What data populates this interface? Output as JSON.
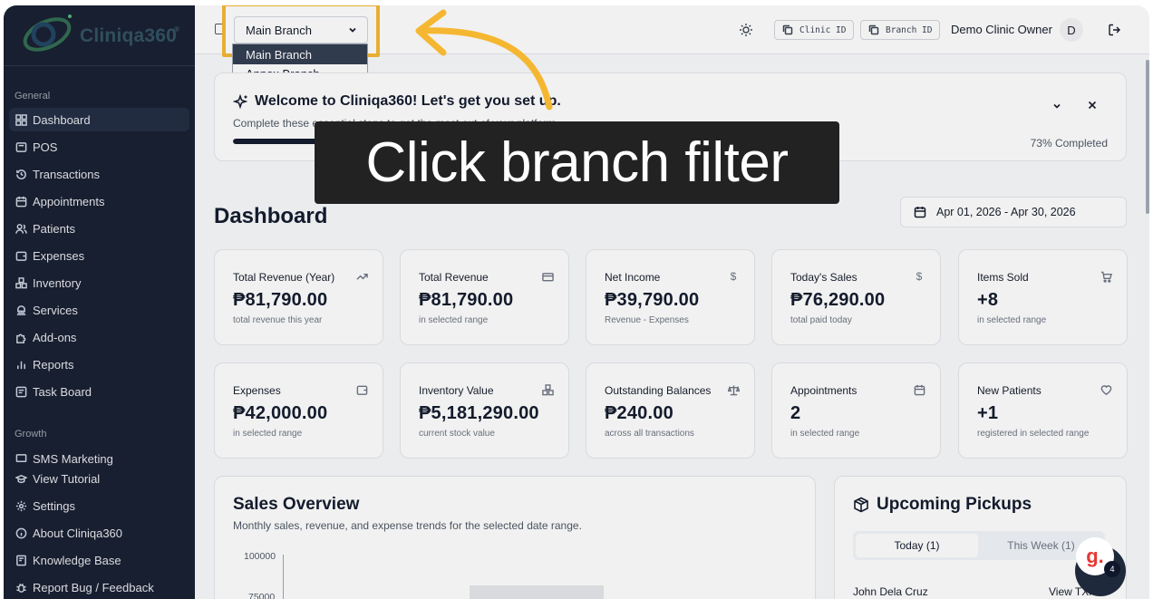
{
  "brand": {
    "name": "Cliniqa360",
    "registered": "®"
  },
  "sidebar": {
    "sections": [
      {
        "label": "General"
      },
      {
        "label": "Growth"
      }
    ],
    "items": [
      {
        "label": "Dashboard",
        "icon": "dashboard-icon",
        "active": true
      },
      {
        "label": "POS",
        "icon": "pos-icon"
      },
      {
        "label": "Transactions",
        "icon": "history-icon"
      },
      {
        "label": "Appointments",
        "icon": "calendar-icon"
      },
      {
        "label": "Patients",
        "icon": "users-icon"
      },
      {
        "label": "Expenses",
        "icon": "wallet-icon"
      },
      {
        "label": "Inventory",
        "icon": "boxes-icon"
      },
      {
        "label": "Services",
        "icon": "services-icon"
      },
      {
        "label": "Add-ons",
        "icon": "puzzle-icon"
      },
      {
        "label": "Reports",
        "icon": "bar-chart-icon"
      },
      {
        "label": "Task Board",
        "icon": "board-icon"
      },
      {
        "label": "SMS Marketing",
        "icon": "message-icon"
      }
    ],
    "bottom_items": [
      {
        "label": "View Tutorial",
        "icon": "graduation-cap-icon"
      },
      {
        "label": "Settings",
        "icon": "gear-icon"
      },
      {
        "label": "About Cliniqa360",
        "icon": "info-icon"
      },
      {
        "label": "Knowledge Base",
        "icon": "book-icon"
      },
      {
        "label": "Report Bug / Feedback",
        "icon": "bug-icon"
      }
    ]
  },
  "header": {
    "branch_selected": "Main Branch",
    "branch_options": [
      "Main Branch",
      "Annex Branch"
    ],
    "clinic_id_label": "Clinic ID",
    "branch_id_label": "Branch ID",
    "owner_name": "Demo Clinic Owner",
    "avatar_initial": "D"
  },
  "welcome": {
    "title": "Welcome to Cliniqa360! Let's get you set up.",
    "subtitle": "Complete these essential steps to get the most out of your platform.",
    "progress_percent": 73,
    "progress_text": "73% Completed"
  },
  "dashboard": {
    "title": "Dashboard",
    "date_range": "Apr 01, 2026 - Apr 30, 2026",
    "kpis": [
      {
        "label": "Total Revenue (Year)",
        "value": "₱81,790.00",
        "sub": "total revenue this year",
        "icon": "trending-up-icon"
      },
      {
        "label": "Total Revenue",
        "value": "₱81,790.00",
        "sub": "in selected range",
        "icon": "credit-card-icon"
      },
      {
        "label": "Net Income",
        "value": "₱39,790.00",
        "sub": "Revenue - Expenses",
        "icon": "dollar-icon"
      },
      {
        "label": "Today's Sales",
        "value": "₱76,290.00",
        "sub": "total paid today",
        "icon": "dollar-icon"
      },
      {
        "label": "Items Sold",
        "value": "+8",
        "sub": "in selected range",
        "icon": "cart-icon"
      },
      {
        "label": "Expenses",
        "value": "₱42,000.00",
        "sub": "in selected range",
        "icon": "wallet-icon"
      },
      {
        "label": "Inventory Value",
        "value": "₱5,181,290.00",
        "sub": "current stock value",
        "icon": "boxes-icon"
      },
      {
        "label": "Outstanding Balances",
        "value": "₱240.00",
        "sub": "across all transactions",
        "icon": "scale-icon"
      },
      {
        "label": "Appointments",
        "value": "2",
        "sub": "in selected range",
        "icon": "calendar-icon"
      },
      {
        "label": "New Patients",
        "value": "+1",
        "sub": "registered in selected range",
        "icon": "heart-icon"
      }
    ]
  },
  "sales_overview": {
    "title": "Sales Overview",
    "subtitle": "Monthly sales, revenue, and expense trends for the selected date range.",
    "y_ticks": [
      "100000",
      "75000"
    ]
  },
  "pickups": {
    "title": "Upcoming Pickups",
    "tabs": [
      "Today (1)",
      "This Week (1)"
    ],
    "rows": [
      {
        "name": "John Dela Cruz",
        "action": "View TXN"
      }
    ]
  },
  "overlay": {
    "tooltip": "Click branch filter",
    "chat_badge": "4",
    "chat_logo": "g."
  },
  "colors": {
    "accent": "#f5b731",
    "sidebar": "#141c2e",
    "ink": "#0f172a"
  }
}
